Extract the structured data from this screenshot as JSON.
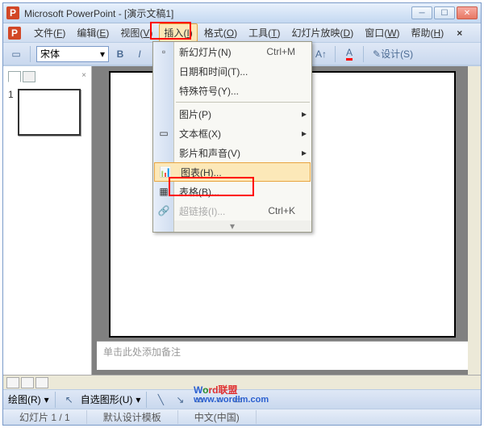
{
  "title": "Microsoft PowerPoint - [演示文稿1]",
  "menubar": {
    "items": [
      {
        "label": "文件",
        "hot": "F"
      },
      {
        "label": "编辑",
        "hot": "E"
      },
      {
        "label": "视图",
        "hot": "V"
      },
      {
        "label": "插入",
        "hot": "I"
      },
      {
        "label": "格式",
        "hot": "O"
      },
      {
        "label": "工具",
        "hot": "T"
      },
      {
        "label": "幻灯片放映",
        "hot": "D"
      },
      {
        "label": "窗口",
        "hot": "W"
      },
      {
        "label": "帮助",
        "hot": "H"
      }
    ],
    "close": "×"
  },
  "toolbar": {
    "font": "宋体",
    "design": "设计(S)"
  },
  "dropdown": {
    "items": [
      {
        "label": "新幻灯片(N)",
        "shortcut": "Ctrl+M",
        "icon": "new-slide-icon"
      },
      {
        "label": "日期和时间(T)...",
        "shortcut": "",
        "icon": ""
      },
      {
        "label": "特殊符号(Y)...",
        "shortcut": "",
        "icon": ""
      },
      {
        "sep": true
      },
      {
        "label": "图片(P)",
        "shortcut": "",
        "icon": "",
        "arrow": true
      },
      {
        "label": "文本框(X)",
        "shortcut": "",
        "icon": "textbox-icon",
        "arrow": true
      },
      {
        "label": "影片和声音(V)",
        "shortcut": "",
        "icon": "",
        "arrow": true
      },
      {
        "label": "图表(H)...",
        "shortcut": "",
        "icon": "chart-icon",
        "highlight": true
      },
      {
        "label": "表格(B)...",
        "shortcut": "",
        "icon": "table-icon"
      },
      {
        "label": "超链接(I)...",
        "shortcut": "Ctrl+K",
        "icon": "link-icon",
        "disabled": true
      },
      {
        "expand": true
      }
    ]
  },
  "thumbnails": {
    "num": "1"
  },
  "notes": {
    "placeholder": "单击此处添加备注"
  },
  "drawbar": {
    "draw": "绘图(R)",
    "autoshape": "自选图形(U)"
  },
  "status": {
    "slide": "幻灯片 1 / 1",
    "template": "默认设计模板",
    "lang": "中文(中国)"
  },
  "watermark": {
    "l1a": "W",
    "l1b": "o",
    "l1c": "rd",
    "l1d": "联盟",
    "l2": "www.wordlm.com"
  }
}
